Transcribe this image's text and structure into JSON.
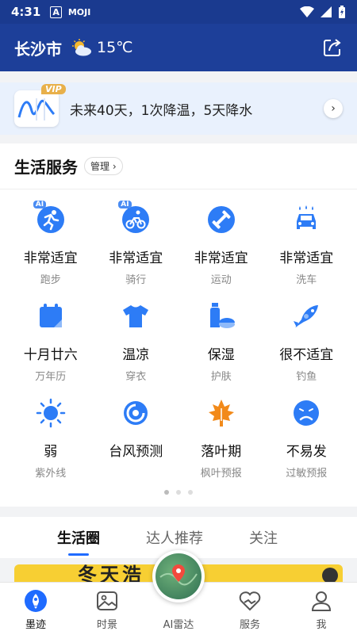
{
  "status_bar": {
    "time": "4:31",
    "app_icon_a": "A",
    "app_icon_moji": "MOJI",
    "icons": [
      "wifi-icon",
      "signal-icon",
      "battery-icon"
    ]
  },
  "header": {
    "city": "长沙市",
    "temperature": "15℃",
    "weather_icon": "partly-cloudy-icon",
    "share_icon": "share-icon"
  },
  "forecast": {
    "badge": "VIP",
    "text": "未来40天，1次降温，5天降水",
    "arrow": "›"
  },
  "services": {
    "title": "生活服务",
    "manage_label": "管理 ›",
    "items": [
      {
        "value": "非常适宜",
        "label": "跑步",
        "icon": "running-icon",
        "ai": "AI"
      },
      {
        "value": "非常适宜",
        "label": "骑行",
        "icon": "cycling-icon",
        "ai": "AI"
      },
      {
        "value": "非常适宜",
        "label": "运动",
        "icon": "dumbbell-icon",
        "ai": ""
      },
      {
        "value": "非常适宜",
        "label": "洗车",
        "icon": "car-wash-icon",
        "ai": ""
      },
      {
        "value": "十月廿六",
        "label": "万年历",
        "icon": "calendar-icon",
        "ai": ""
      },
      {
        "value": "温凉",
        "label": "穿衣",
        "icon": "tshirt-icon",
        "ai": ""
      },
      {
        "value": "保湿",
        "label": "护肤",
        "icon": "skincare-icon",
        "ai": ""
      },
      {
        "value": "很不适宜",
        "label": "钓鱼",
        "icon": "fish-icon",
        "ai": ""
      },
      {
        "value": "弱",
        "label": "紫外线",
        "icon": "sun-icon",
        "ai": ""
      },
      {
        "value": "台风预测",
        "label": "",
        "icon": "typhoon-icon",
        "ai": ""
      },
      {
        "value": "落叶期",
        "label": "枫叶预报",
        "icon": "maple-leaf-icon",
        "ai": ""
      },
      {
        "value": "不易发",
        "label": "过敏预报",
        "icon": "allergy-face-icon",
        "ai": ""
      }
    ],
    "page_indicator": {
      "pages": 3,
      "current": 1
    }
  },
  "feed_tabs": [
    {
      "label": "生活圈",
      "active": true
    },
    {
      "label": "达人推荐",
      "active": false
    },
    {
      "label": "关注",
      "active": false
    }
  ],
  "banner": {
    "text": "冬天浩"
  },
  "bottom_nav": [
    {
      "label": "墨迹",
      "icon": "moji-home-icon",
      "active": true
    },
    {
      "label": "时景",
      "icon": "landscape-photo-icon",
      "active": false
    },
    {
      "label": "AI雷达",
      "icon": "radar-map-icon",
      "active": false
    },
    {
      "label": "服务",
      "icon": "heart-hands-icon",
      "active": false
    },
    {
      "label": "我",
      "icon": "profile-icon",
      "active": false
    }
  ],
  "colors": {
    "header_bg": "#1d3f99",
    "accent_blue": "#1f6bff",
    "icon_blue": "#2d7cf6",
    "icon_orange": "#f28a1a",
    "banner_yellow": "#f7cf33"
  }
}
